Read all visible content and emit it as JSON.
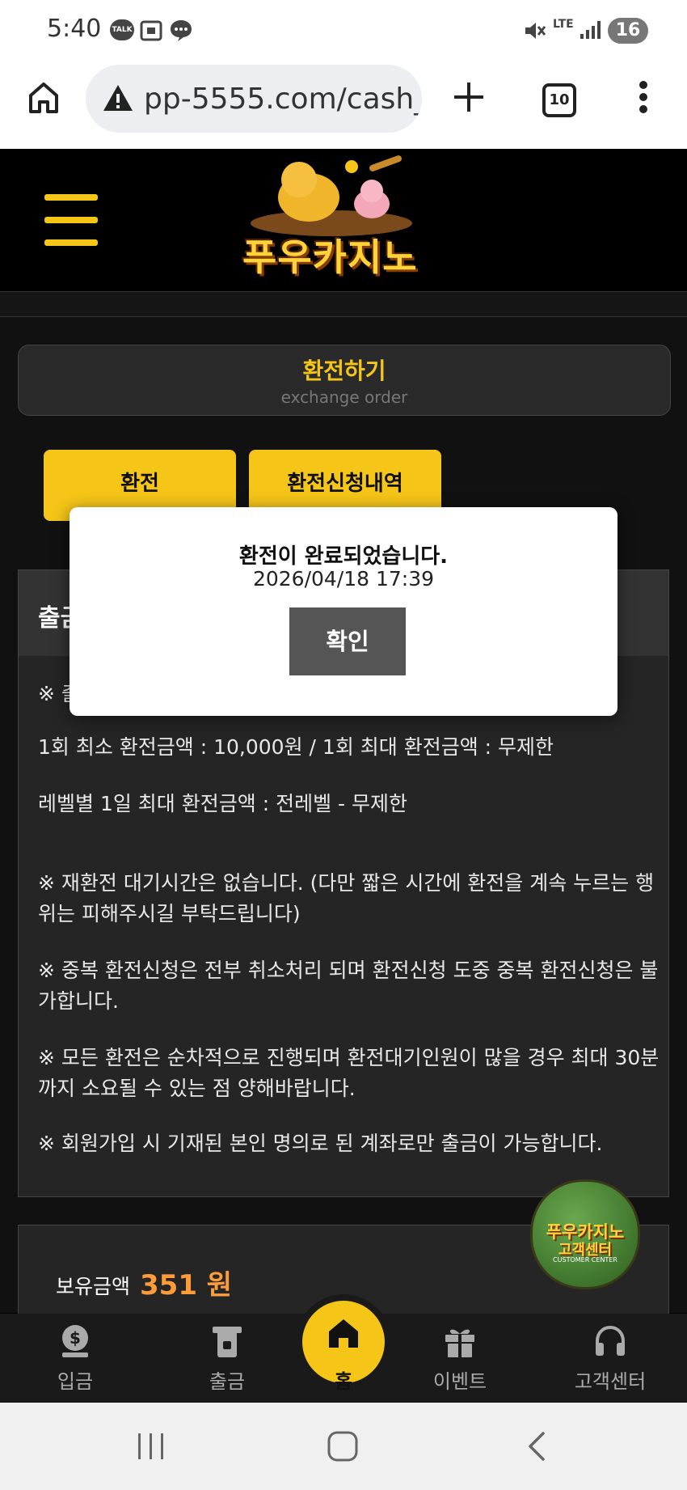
{
  "status_bar": {
    "time": "5:40",
    "notification_icons": [
      "talk-icon",
      "screenshot-icon",
      "message-icon"
    ],
    "network": "LTE",
    "battery": "16"
  },
  "browser": {
    "url": "pp-5555.com/cash_(",
    "tab_count": "10"
  },
  "site": {
    "logo_text": "푸우카지노"
  },
  "page": {
    "title": "환전하기",
    "subtitle": "exchange order",
    "tabs": [
      {
        "label": "환전"
      },
      {
        "label": "환전신청내역"
      }
    ],
    "info_header": "출금",
    "info_first_line": "※ 출",
    "info_lines": [
      "1회 최소 환전금액 : 10,000원 / 1회 최대 환전금액 : 무제한",
      "레벨별 1일 최대 환전금액 : 전레벨 - 무제한",
      "※ 재환전 대기시간은 없습니다. (다만 짧은 시간에 환전을 계속 누르는 행위는 피해주시길 부탁드립니다)",
      "※ 중복 환전신청은 전부 취소처리 되며 환전신청 도중 중복 환전신청은 불가합니다.",
      "※ 모든 환전은 순차적으로 진행되며 환전대기인원이 많을 경우 최대 30분까지 소요될 수 있는 점 양해바랍니다.",
      "※ 회원가입 시 기재된 본인 명의로 된 계좌로만 출금이 가능합니다."
    ],
    "balance_label": "보유금액",
    "balance_amount": "351 원"
  },
  "customer_center_badge": {
    "title": "푸우카지노",
    "subtitle": "고객센터",
    "small": "CUSTOMER CENTER"
  },
  "bottom_nav": [
    {
      "label": "입금",
      "icon": "deposit-icon"
    },
    {
      "label": "출금",
      "icon": "withdraw-icon"
    },
    {
      "label": "홈",
      "icon": "home-icon"
    },
    {
      "label": "이벤트",
      "icon": "gift-icon"
    },
    {
      "label": "고객센터",
      "icon": "headset-icon"
    }
  ],
  "modal": {
    "message": "환전이 완료되었습니다.",
    "datetime": "2026/04/18 17:39",
    "ok_label": "확인"
  },
  "colors": {
    "accent": "#f5c518",
    "balance": "#ff9c3a",
    "modal_button": "#555555"
  }
}
